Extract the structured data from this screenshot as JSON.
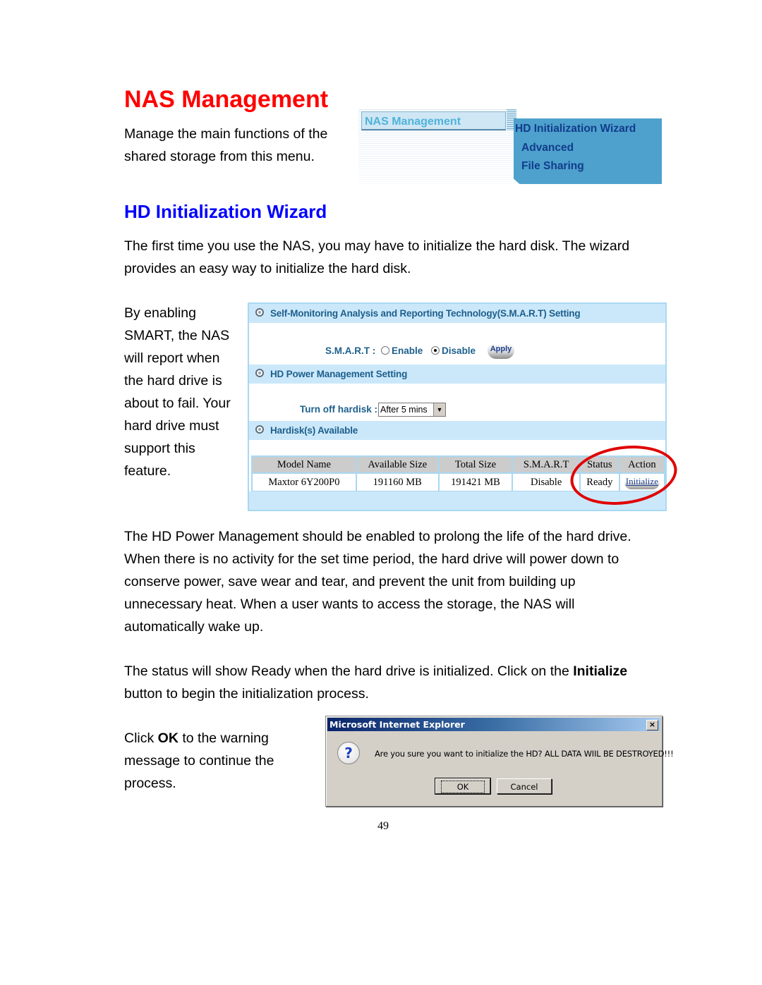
{
  "page": {
    "title": "NAS Management",
    "intro": "Manage the main functions of the shared storage from this menu.",
    "section_title": "HD Initialization Wizard",
    "paragraph1": "The first time you use the NAS, you may have to initialize the hard disk. The wizard provides an easy way to initialize the hard disk.",
    "smart_note": "By enabling SMART, the NAS will report when the hard drive is about to fail. Your hard drive must support this feature.",
    "paragraph2": "The HD Power Management should be enabled to prolong the life of the hard drive. When there is no activity for the set time period, the hard drive will power down to conserve power, save wear and tear, and prevent the unit from building up unnecessary heat. When a user wants to access the storage, the NAS will automatically wake up.",
    "paragraph3_pre": "The status will show Ready when the hard drive is initialized. Click on the ",
    "paragraph3_bold": "Initialize",
    "paragraph3_post": " button to begin the initialization process.",
    "ok_note_pre": "Click ",
    "ok_note_bold": "OK",
    "ok_note_post": " to the warning message to continue the process.",
    "page_number": "49"
  },
  "menu_screenshot": {
    "tab_label": "NAS Management",
    "items": [
      "HD Initialization Wizard",
      "Advanced",
      "File Sharing"
    ]
  },
  "nas_screenshot": {
    "smart_section": "Self-Monitoring Analysis and Reporting Technology(S.M.A.R.T) Setting",
    "smart_label": "S.M.A.R.T :",
    "smart_options": [
      "Enable",
      "Disable"
    ],
    "smart_selected": "Disable",
    "apply_label": "Apply",
    "power_section": "HD Power Management Setting",
    "turn_off_label": "Turn off hardisk :",
    "turn_off_value": "After 5 mins",
    "disks_section": "Hardisk(s) Available",
    "table": {
      "headers": [
        "Model Name",
        "Available Size",
        "Total Size",
        "S.M.A.R.T",
        "Status",
        "Action"
      ],
      "rows": [
        [
          "Maxtor 6Y200P0",
          "191160 MB",
          "191421 MB",
          "Disable",
          "Ready",
          "Initialize"
        ]
      ]
    }
  },
  "dialog": {
    "title": "Microsoft Internet Explorer",
    "message": "Are you sure you want to initialize the HD? ALL DATA WIIL BE DESTROYED!!!",
    "ok_label": "OK",
    "cancel_label": "Cancel",
    "close_glyph": "×",
    "icon_glyph": "?"
  },
  "colors": {
    "title_red": "#ff0000",
    "section_blue": "#0000ff",
    "highlight_ellipse": "#e00000"
  }
}
